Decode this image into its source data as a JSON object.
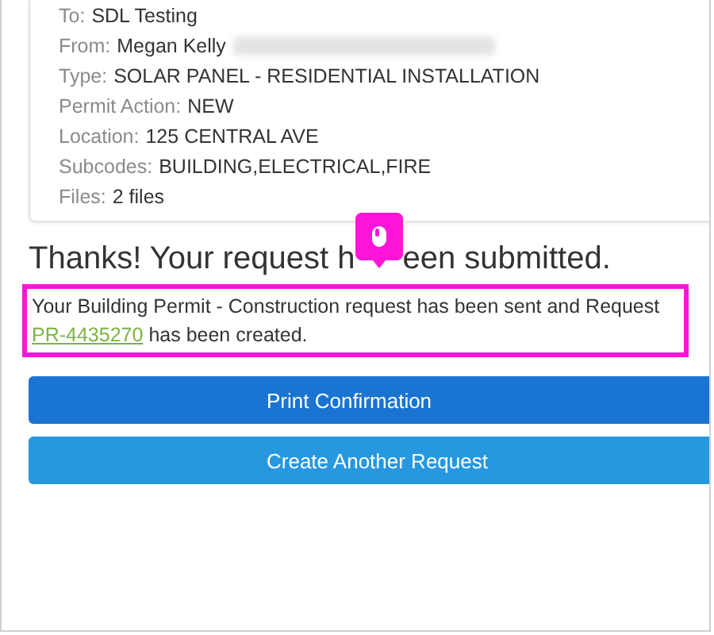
{
  "details": [
    {
      "label": "To:",
      "value": "SDL Testing",
      "redacted": false
    },
    {
      "label": "From:",
      "value": "Megan Kelly",
      "redacted": true
    },
    {
      "label": "Type:",
      "value": "SOLAR PANEL - RESIDENTIAL INSTALLATION",
      "redacted": false
    },
    {
      "label": "Permit Action:",
      "value": "NEW",
      "redacted": false
    },
    {
      "label": "Location:",
      "value": "125 CENTRAL AVE",
      "redacted": false
    },
    {
      "label": "Subcodes:",
      "value": "BUILDING,ELECTRICAL,FIRE",
      "redacted": false
    },
    {
      "label": "Files:",
      "value": "2 files",
      "redacted": false
    }
  ],
  "heading": {
    "before": "Thanks! Your request h",
    "after": "een submitted."
  },
  "message": {
    "before": "Your Building Permit - Construction request has been sent and Request",
    "link": "PR-4435270",
    "after": "has been created.",
    "highlighted": true
  },
  "buttons": [
    {
      "label": "Print Confirmation",
      "kind": "primary"
    },
    {
      "label": "Create Another Request",
      "kind": "secondary"
    }
  ]
}
